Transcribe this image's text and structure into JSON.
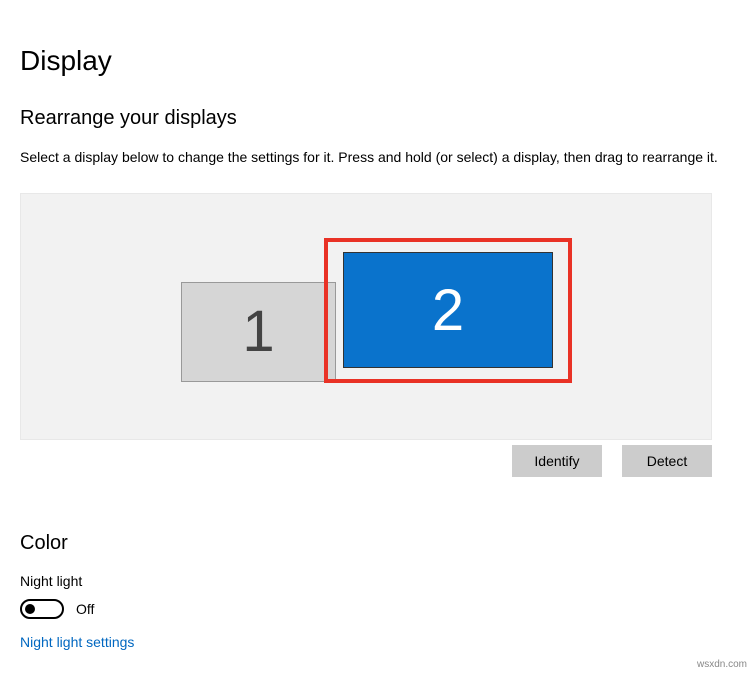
{
  "page": {
    "title": "Display"
  },
  "rearrange": {
    "heading": "Rearrange your displays",
    "description": "Select a display below to change the settings for it. Press and hold (or select) a display, then drag to rearrange it.",
    "displays": {
      "display1": {
        "label": "1",
        "selected": false
      },
      "display2": {
        "label": "2",
        "selected": true,
        "highlighted": true
      }
    },
    "buttons": {
      "identify": "Identify",
      "detect": "Detect"
    }
  },
  "color": {
    "heading": "Color",
    "nightLight": {
      "label": "Night light",
      "state": "Off",
      "value": false,
      "settingsLink": "Night light settings"
    }
  },
  "colors": {
    "selectedDisplay": "#0a73cc",
    "highlightBorder": "#e93226",
    "linkColor": "#0067c0"
  },
  "watermark": "wsxdn.com"
}
